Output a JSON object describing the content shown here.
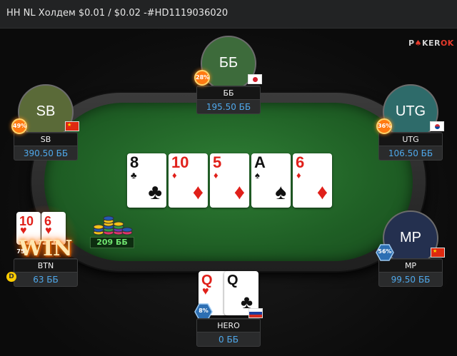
{
  "window": {
    "title": "HH NL Холдем $0.01 / $0.02 -#HD1119036020"
  },
  "logo": {
    "text_a": "P",
    "text_k": "♠",
    "text_b": "KER",
    "text_c": "OK"
  },
  "board": [
    {
      "rank": "8",
      "suit": "♣",
      "color": "black"
    },
    {
      "rank": "10",
      "suit": "♦",
      "color": "red"
    },
    {
      "rank": "5",
      "suit": "♦",
      "color": "red"
    },
    {
      "rank": "A",
      "suit": "♠",
      "color": "black"
    },
    {
      "rank": "6",
      "suit": "♦",
      "color": "red"
    }
  ],
  "pot": {
    "amount": "209 ББ"
  },
  "seats": {
    "bb": {
      "avatar": "ББ",
      "name": "ББ",
      "stack": "195.50 ББ",
      "badge": "28%",
      "flag": "japan-flag"
    },
    "sb": {
      "avatar": "SB",
      "name": "SB",
      "stack": "390.50 ББ",
      "badge": "49%",
      "flag": "china-flag"
    },
    "utg": {
      "avatar": "UTG",
      "name": "UTG",
      "stack": "106.50 ББ",
      "badge": "36%",
      "flag": "korea-flag"
    },
    "mp": {
      "avatar": "MP",
      "name": "MP",
      "stack": "99.50 ББ",
      "badge": "56%",
      "flag": "china-flag"
    },
    "btn": {
      "name": "BTN",
      "stack": "63 ББ",
      "badge": "75",
      "win": "WIN",
      "dealer": "D",
      "cards": [
        {
          "rank": "10",
          "suit": "♥"
        },
        {
          "rank": "6",
          "suit": "♥"
        }
      ]
    },
    "hero": {
      "name": "HERO",
      "stack": "0 ББ",
      "badge": "8%",
      "flag": "russia-flag",
      "cards": [
        {
          "rank": "Q",
          "suit": "♥",
          "color": "red"
        },
        {
          "rank": "Q",
          "suit": "♣",
          "color": "black"
        }
      ]
    }
  },
  "colors": {
    "felt": "#2a7030",
    "stack_text": "#4fa8ea",
    "pot_text": "#6fe36f",
    "badge_fire": "#ff7a12",
    "badge_hex": "#2d6fb3"
  }
}
